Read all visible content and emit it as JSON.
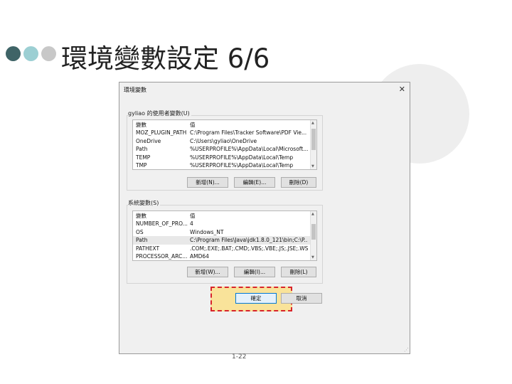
{
  "slide": {
    "title": "環境變數設定 6/6",
    "page_number": "1-22"
  },
  "dialog": {
    "title": "環境變數",
    "close_glyph": "✕",
    "user_section": {
      "label": "gyliao 的使用者變數(U)",
      "columns": {
        "name": "變數",
        "value": "值"
      },
      "rows": [
        {
          "name": "MOZ_PLUGIN_PATH",
          "value": "C:\\Program Files\\Tracker Software\\PDF Vie..."
        },
        {
          "name": "OneDrive",
          "value": "C:\\Users\\gyliao\\OneDrive"
        },
        {
          "name": "Path",
          "value": "%USERPROFILE%\\AppData\\Local\\Microsoft..."
        },
        {
          "name": "TEMP",
          "value": "%USERPROFILE%\\AppData\\Local\\Temp"
        },
        {
          "name": "TMP",
          "value": "%USERPROFILE%\\AppData\\Local\\Temp"
        }
      ],
      "buttons": {
        "new": "新增(N)...",
        "edit": "編輯(E)...",
        "delete": "刪除(D)"
      }
    },
    "system_section": {
      "label": "系統變數(S)",
      "columns": {
        "name": "變數",
        "value": "值"
      },
      "rows": [
        {
          "name": "NUMBER_OF_PRO...",
          "value": "4"
        },
        {
          "name": "OS",
          "value": "Windows_NT"
        },
        {
          "name": "Path",
          "value": "C:\\Program Files\\Java\\jdk1.8.0_121\\bin;C:\\P..."
        },
        {
          "name": "PATHEXT",
          "value": ".COM;.EXE;.BAT;.CMD;.VBS;.VBE;.JS;.JSE;.WSF;..."
        },
        {
          "name": "PROCESSOR_ARC...",
          "value": "AMD64"
        }
      ],
      "buttons": {
        "new": "新增(W)...",
        "edit": "編輯(I)...",
        "delete": "刪除(L)"
      }
    },
    "ok_label": "確定",
    "cancel_label": "取消",
    "resize_grip_glyph": "⋰"
  },
  "colors": {
    "highlight_fill": "#f9e39a",
    "highlight_border": "#d8232a",
    "dot_dark": "#3f6467",
    "dot_teal": "#9ccfd3",
    "dot_gray": "#c8c8c8"
  },
  "icons": [
    "close-icon",
    "scroll-up-icon",
    "scroll-down-icon",
    "resize-grip-icon"
  ]
}
